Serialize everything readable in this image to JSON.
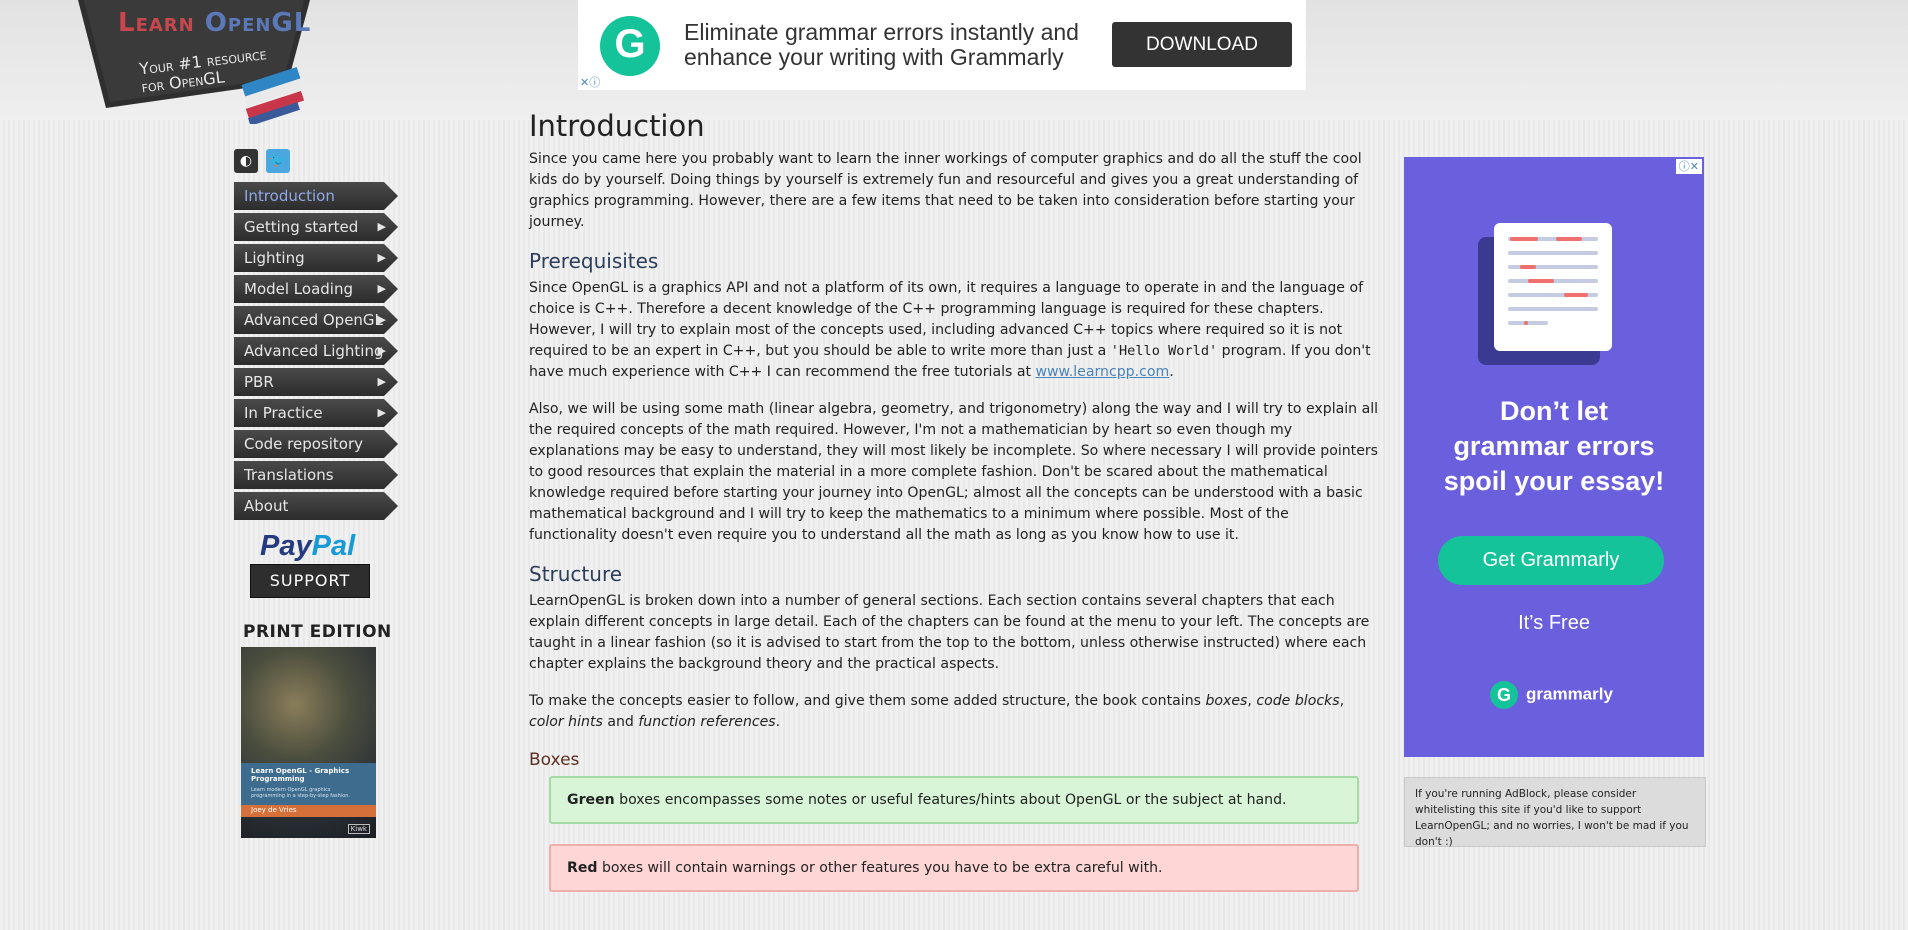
{
  "logo": {
    "title_part1": "Learn ",
    "title_part2": "OpenGL",
    "tagline": "Your #1 resource for OpenGL"
  },
  "top_ad": {
    "icon_letter": "G",
    "text_line1": "Eliminate grammar errors instantly and",
    "text_line2": "enhance your writing with Grammarly",
    "button": "DOWNLOAD",
    "adchoices": "✕ⓘ"
  },
  "social": {
    "github": "◐",
    "twitter": "🐦"
  },
  "menu": [
    {
      "label": "Introduction",
      "arrow": ""
    },
    {
      "label": "Getting started",
      "arrow": "▶"
    },
    {
      "label": "Lighting",
      "arrow": "▶"
    },
    {
      "label": "Model Loading",
      "arrow": "▶"
    },
    {
      "label": "Advanced OpenGL",
      "arrow": "▶"
    },
    {
      "label": "Advanced Lighting",
      "arrow": "▶"
    },
    {
      "label": "PBR",
      "arrow": "▶"
    },
    {
      "label": "In Practice",
      "arrow": "▶"
    },
    {
      "label": "Code repository",
      "arrow": ""
    },
    {
      "label": "Translations",
      "arrow": ""
    },
    {
      "label": "About",
      "arrow": ""
    }
  ],
  "paypal": {
    "part1": "Pay",
    "part2": "Pal",
    "button": "SUPPORT"
  },
  "print_edition": {
    "heading": "PRINT EDITION",
    "book_title": "Learn OpenGL - Graphics Programming",
    "book_subtitle": "Learn modern OpenGL graphics programming in a step-by-step fashion.",
    "author": "Joey de Vries",
    "publisher": "Kiwk"
  },
  "content": {
    "title": "Introduction",
    "intro": "Since you came here you probably want to learn the inner workings of computer graphics and do all the stuff the cool kids do by yourself. Doing things by yourself is extremely fun and resourceful and gives you a great understanding of graphics programming. However, there are a few items that need to be taken into consideration before starting your journey.",
    "prereq_heading": "Prerequisites",
    "prereq_p1_a": "Since OpenGL is a graphics API and not a platform of its own, it requires a language to operate in and the language of choice is ",
    "cpp": "C++",
    "prereq_p1_b": ". Therefore a decent knowledge of the ",
    "prereq_p1_c": " programming language is required for these chapters. However, I will try to explain most of the concepts used, including advanced ",
    "prereq_p1_d": " topics where required so it is not required to be an expert in ",
    "prereq_p1_e": ", but you should be able to write more than just a ",
    "hello_world": "'Hello World'",
    "prereq_p1_f": " program. If you don't have much experience with ",
    "prereq_p1_g": " I can recommend the free tutorials at ",
    "learncpp_link": "www.learncpp.com",
    "period": ".",
    "prereq_p2": "Also, we will be using some math (linear algebra, geometry, and trigonometry) along the way and I will try to explain all the required concepts of the math required. However, I'm not a mathematician by heart so even though my explanations may be easy to understand, they will most likely be incomplete. So where necessary I will provide pointers to good resources that explain the material in a more complete fashion. Don't be scared about the mathematical knowledge required before starting your journey into OpenGL; almost all the concepts can be understood with a basic mathematical background and I will try to keep the mathematics to a minimum where possible. Most of the functionality doesn't even require you to understand all the math as long as you know how to use it.",
    "structure_heading": "Structure",
    "structure_p1": "LearnOpenGL is broken down into a number of general sections. Each section contains several chapters that each explain different concepts in large detail. Each of the chapters can be found at the menu to your left. The concepts are taught in a linear fashion (so it is advised to start from the top to the bottom, unless otherwise instructed) where each chapter explains the background theory and the practical aspects.",
    "structure_p2_a": "To make the concepts easier to follow, and give them some added structure, the book contains ",
    "em_boxes": "boxes",
    "comma1": ", ",
    "em_code": "code blocks",
    "comma2": ", ",
    "em_color": "color hints",
    "and": " and ",
    "em_function": "function references",
    "boxes_heading": "Boxes",
    "green_bold": "Green",
    "green_text": " boxes encompasses some notes or useful features/hints about OpenGL or the subject at hand.",
    "red_bold": "Red",
    "red_text": " boxes will contain warnings or other features you have to be extra careful with."
  },
  "side_ad": {
    "controls": "ⓘ✕",
    "headline_1": "Don’t let",
    "headline_2": "grammar errors",
    "headline_3": "spoil your essay!",
    "button": "Get Grammarly",
    "free": "It’s Free",
    "brand_icon": "G",
    "brand": "grammarly"
  },
  "adblock_notice": "If you're running AdBlock, please consider whitelisting this site if you'd like to support LearnOpenGL; and no worries, I won't be mad if you don't :)"
}
